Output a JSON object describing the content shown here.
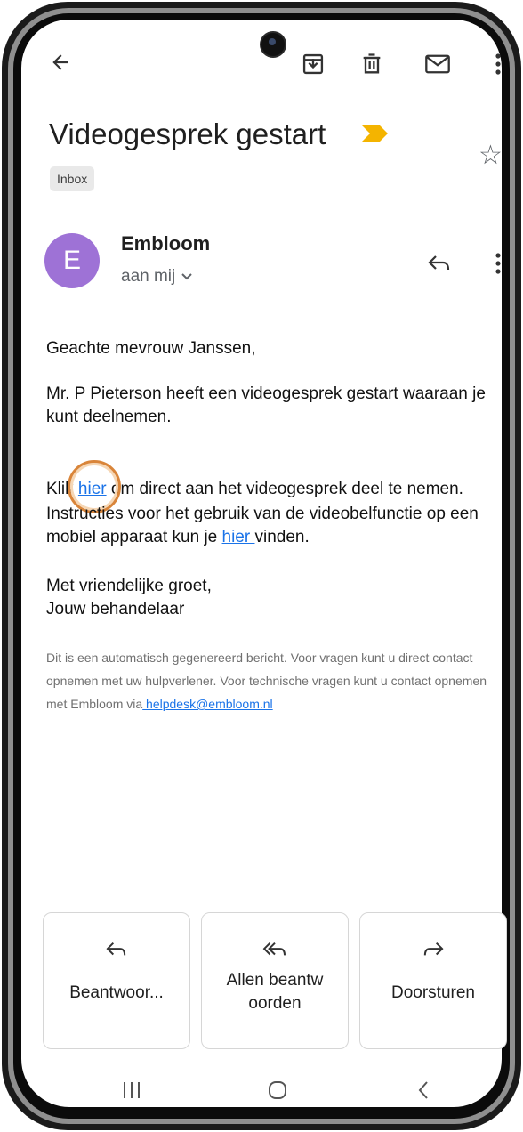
{
  "toolbar": {
    "back_icon": "arrow-left-icon",
    "archive_icon": "archive-icon",
    "delete_icon": "trash-icon",
    "mark_unread_icon": "mail-icon",
    "more_icon": "more-vert-icon"
  },
  "email": {
    "subject": "Videogesprek gestart",
    "label": "Inbox",
    "sender_initial": "E",
    "sender_name": "Embloom",
    "recipient": "aan mij",
    "body": {
      "greeting": "Geachte mevrouw Janssen,",
      "p1": "Mr. P Pieterson heeft een videogesprek gestart waaraan je kunt deelnemen.",
      "p2_before": "Klik ",
      "p2_link": "hier",
      "p2_after": " om direct aan het videogesprek deel te nemen.",
      "p3_before": "Instructies voor het gebruik van de videobelfunctie op een mobiel apparaat kun je ",
      "p3_link": "hier ",
      "p3_after": "vinden.",
      "closing1": "Met vriendelijke groet,",
      "closing2": "Jouw behandelaar"
    },
    "footer_text": "Dit is een automatisch gegenereerd bericht. Voor vragen kunt u direct contact opnemen met uw hulpverlener. Voor technische vragen kunt u contact opnemen met Embloom via",
    "footer_link": " helpdesk@embloom.nl"
  },
  "actions": {
    "reply": "Beantwoor...",
    "reply_all_line1": "Allen beantw",
    "reply_all_line2": "oorden",
    "forward": "Doorsturen"
  },
  "colors": {
    "avatar": "#9e72d6",
    "link": "#1a73e8",
    "importance_marker": "#f4b400",
    "highlight_ring": "#d9853a"
  }
}
